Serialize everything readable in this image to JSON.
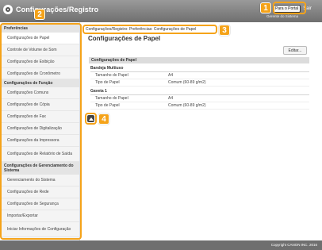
{
  "header": {
    "title": "Configurações/Registro",
    "portal_button": "Para o Portal",
    "logout": "Sair",
    "system_admin": "Gerente do Sistema"
  },
  "sidebar": {
    "section1": "Preferências",
    "items1": [
      "Configurações de Papel",
      "Controle de Volume de Som",
      "Configurações de Exibição",
      "Configurações de Cronômetro"
    ],
    "section2": "Configurações de Função",
    "items2": [
      "Configurações Comuns",
      "Configurações de Cópia",
      "Configurações de Fax",
      "Configurações de Digitalização",
      "Configurações da Impressora",
      "Configurações de Relatório de Saída"
    ],
    "section3": "Configurações de Gerenciamento do Sistema",
    "items3": [
      "Gerenciamento do Sistema",
      "Configurações de Rede",
      "Configurações de Segurança",
      "Importar/Exportar",
      "Iniciar Informações de Configuração"
    ]
  },
  "main": {
    "breadcrumb": "Configurações/Registro: Preferências: Configurações de Papel",
    "page_title": "Configurações de Papel",
    "edit_button": "Editar...",
    "section_title": "Configurações de Papel",
    "groups": [
      {
        "title": "Bandeja Multiuso",
        "rows": [
          {
            "key": "Tamanho do Papel",
            "value": "A4"
          },
          {
            "key": "Tipo de Papel",
            "value": "Comum (60-89 g/m2)"
          }
        ]
      },
      {
        "title": "Gaveta 1",
        "rows": [
          {
            "key": "Tamanho do Papel",
            "value": "A4"
          },
          {
            "key": "Tipo de Papel",
            "value": "Comum (60-89 g/m2)"
          }
        ]
      }
    ]
  },
  "callouts": [
    "1",
    "2",
    "3",
    "4"
  ],
  "footer": {
    "copyright": "Copyright CANON INC. 2016"
  },
  "colors": {
    "callout": "#f5a31a",
    "header": "#7a7a7a"
  },
  "icons": {
    "logo": "settings-logo-icon",
    "top": "back-to-top-icon"
  }
}
